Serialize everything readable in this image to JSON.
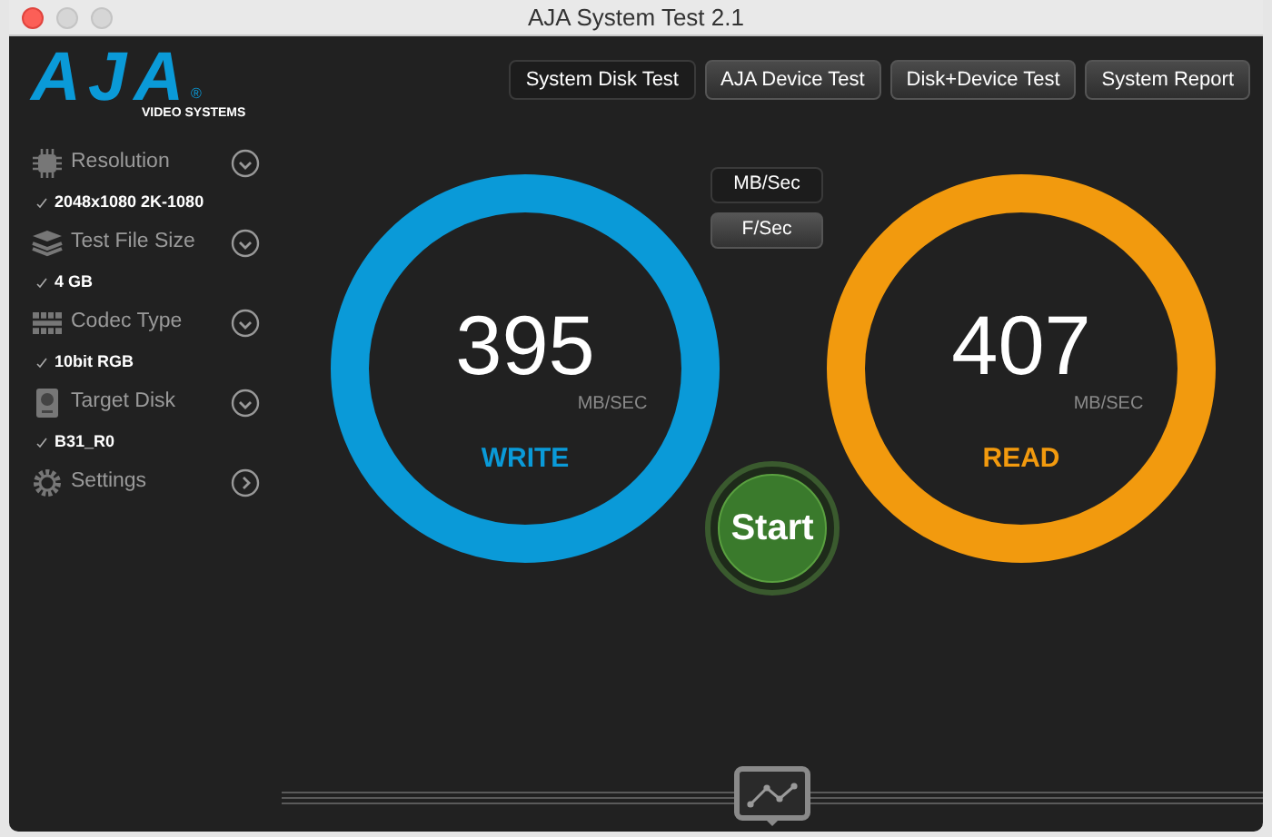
{
  "window": {
    "title": "AJA System Test 2.1"
  },
  "logo": {
    "name": "AJA",
    "tagline": "VIDEO SYSTEMS",
    "mark": "®"
  },
  "sidebar": {
    "items": [
      {
        "kind": "select",
        "label": "Resolution",
        "value": "2048x1080 2K-1080"
      },
      {
        "kind": "select",
        "label": "Test File Size",
        "value": "4 GB"
      },
      {
        "kind": "select",
        "label": "Codec Type",
        "value": "10bit RGB"
      },
      {
        "kind": "select",
        "label": "Target Disk",
        "value": "B31_R0"
      },
      {
        "kind": "link",
        "label": "Settings"
      }
    ]
  },
  "tabs": [
    {
      "label": "System Disk Test",
      "selected": true
    },
    {
      "label": "AJA Device Test",
      "selected": false
    },
    {
      "label": "Disk+Device Test",
      "selected": false
    },
    {
      "label": "System Report",
      "selected": false
    }
  ],
  "units": [
    {
      "label": "MB/Sec",
      "selected": true
    },
    {
      "label": "F/Sec",
      "selected": false
    }
  ],
  "gauges": [
    {
      "label": "WRITE",
      "value": "395",
      "unit": "MB/SEC",
      "color": "#0a9ad8"
    },
    {
      "label": "READ",
      "value": "407",
      "unit": "MB/SEC",
      "color": "#f29a0e"
    }
  ],
  "start_button": {
    "label": "Start"
  }
}
